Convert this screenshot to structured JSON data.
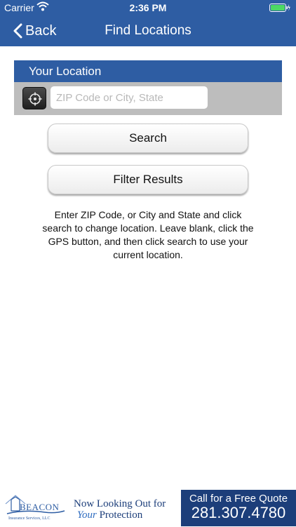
{
  "status_bar": {
    "carrier": "Carrier",
    "time": "2:36 PM"
  },
  "nav": {
    "back_label": "Back",
    "title": "Find Locations"
  },
  "location": {
    "header": "Your Location",
    "input_value": "",
    "input_placeholder": "ZIP Code or City, State"
  },
  "buttons": {
    "search": "Search",
    "filter": "Filter Results"
  },
  "instructions": "Enter ZIP Code, or City and State and click search to change location.  Leave blank, click the GPS button, and then click search to use your current location.",
  "ad": {
    "logo_text": "BEACON",
    "logo_subtext": "Insurance Services, LLC",
    "tagline_line1": "Now Looking Out for",
    "tagline_your": "Your",
    "tagline_rest": "Protection",
    "call_label": "Call for a Free Quote",
    "call_number": "281.307.4780"
  },
  "colors": {
    "brand_blue": "#2e5da3",
    "ad_navy": "#1c3e7a",
    "panel_gray": "#bdbdbd",
    "battery_green": "#4cd964"
  }
}
